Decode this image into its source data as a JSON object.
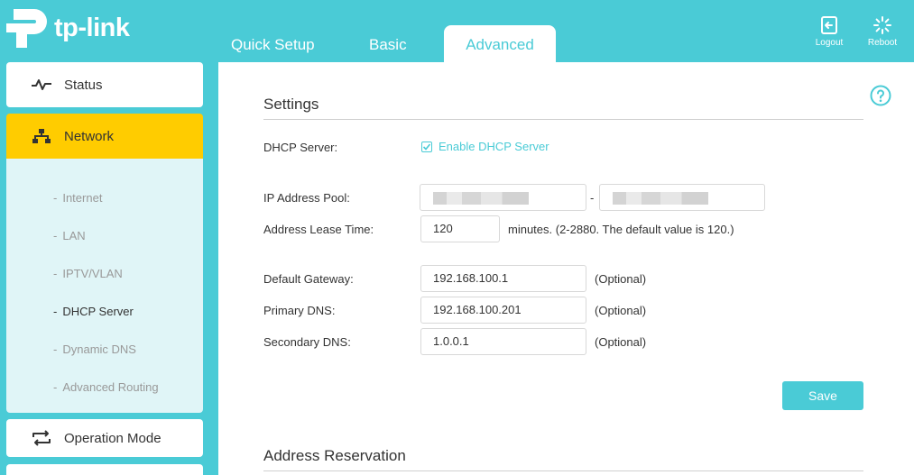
{
  "header": {
    "brand": "tp-link",
    "tabs": [
      {
        "label": "Quick Setup"
      },
      {
        "label": "Basic"
      },
      {
        "label": "Advanced"
      }
    ],
    "logout_label": "Logout",
    "reboot_label": "Reboot"
  },
  "sidebar": {
    "items": [
      {
        "label": "Status",
        "icon": "pulse-icon"
      },
      {
        "label": "Network",
        "icon": "network-icon"
      },
      {
        "label": "Operation Mode",
        "icon": "swap-arrows-icon"
      }
    ],
    "network_submenu": [
      {
        "label": "Internet"
      },
      {
        "label": "LAN"
      },
      {
        "label": "IPTV/VLAN"
      },
      {
        "label": "DHCP Server",
        "active": true
      },
      {
        "label": "Dynamic DNS"
      },
      {
        "label": "Advanced Routing"
      }
    ],
    "sub_dash": "-"
  },
  "main": {
    "settings_title": "Settings",
    "dhcp_server_label": "DHCP Server:",
    "enable_dhcp_label": "Enable DHCP Server",
    "enable_dhcp_checked": true,
    "ip_pool_label": "IP Address Pool:",
    "ip_pool_separator": "-",
    "lease_time_label": "Address Lease Time:",
    "lease_time_value": "120",
    "lease_time_note": "minutes. (2-2880. The default value is 120.)",
    "gateway_label": "Default Gateway:",
    "gateway_value": "192.168.100.1",
    "primary_dns_label": "Primary DNS:",
    "primary_dns_value": "192.168.100.201",
    "secondary_dns_label": "Secondary DNS:",
    "secondary_dns_value": "1.0.0.1",
    "optional_label": "(Optional)",
    "save_label": "Save",
    "reservation_title": "Address Reservation"
  },
  "colors": {
    "accent": "#4acbd6",
    "active_menu": "#ffcc00",
    "submenu_bg": "#e0f5f7"
  }
}
